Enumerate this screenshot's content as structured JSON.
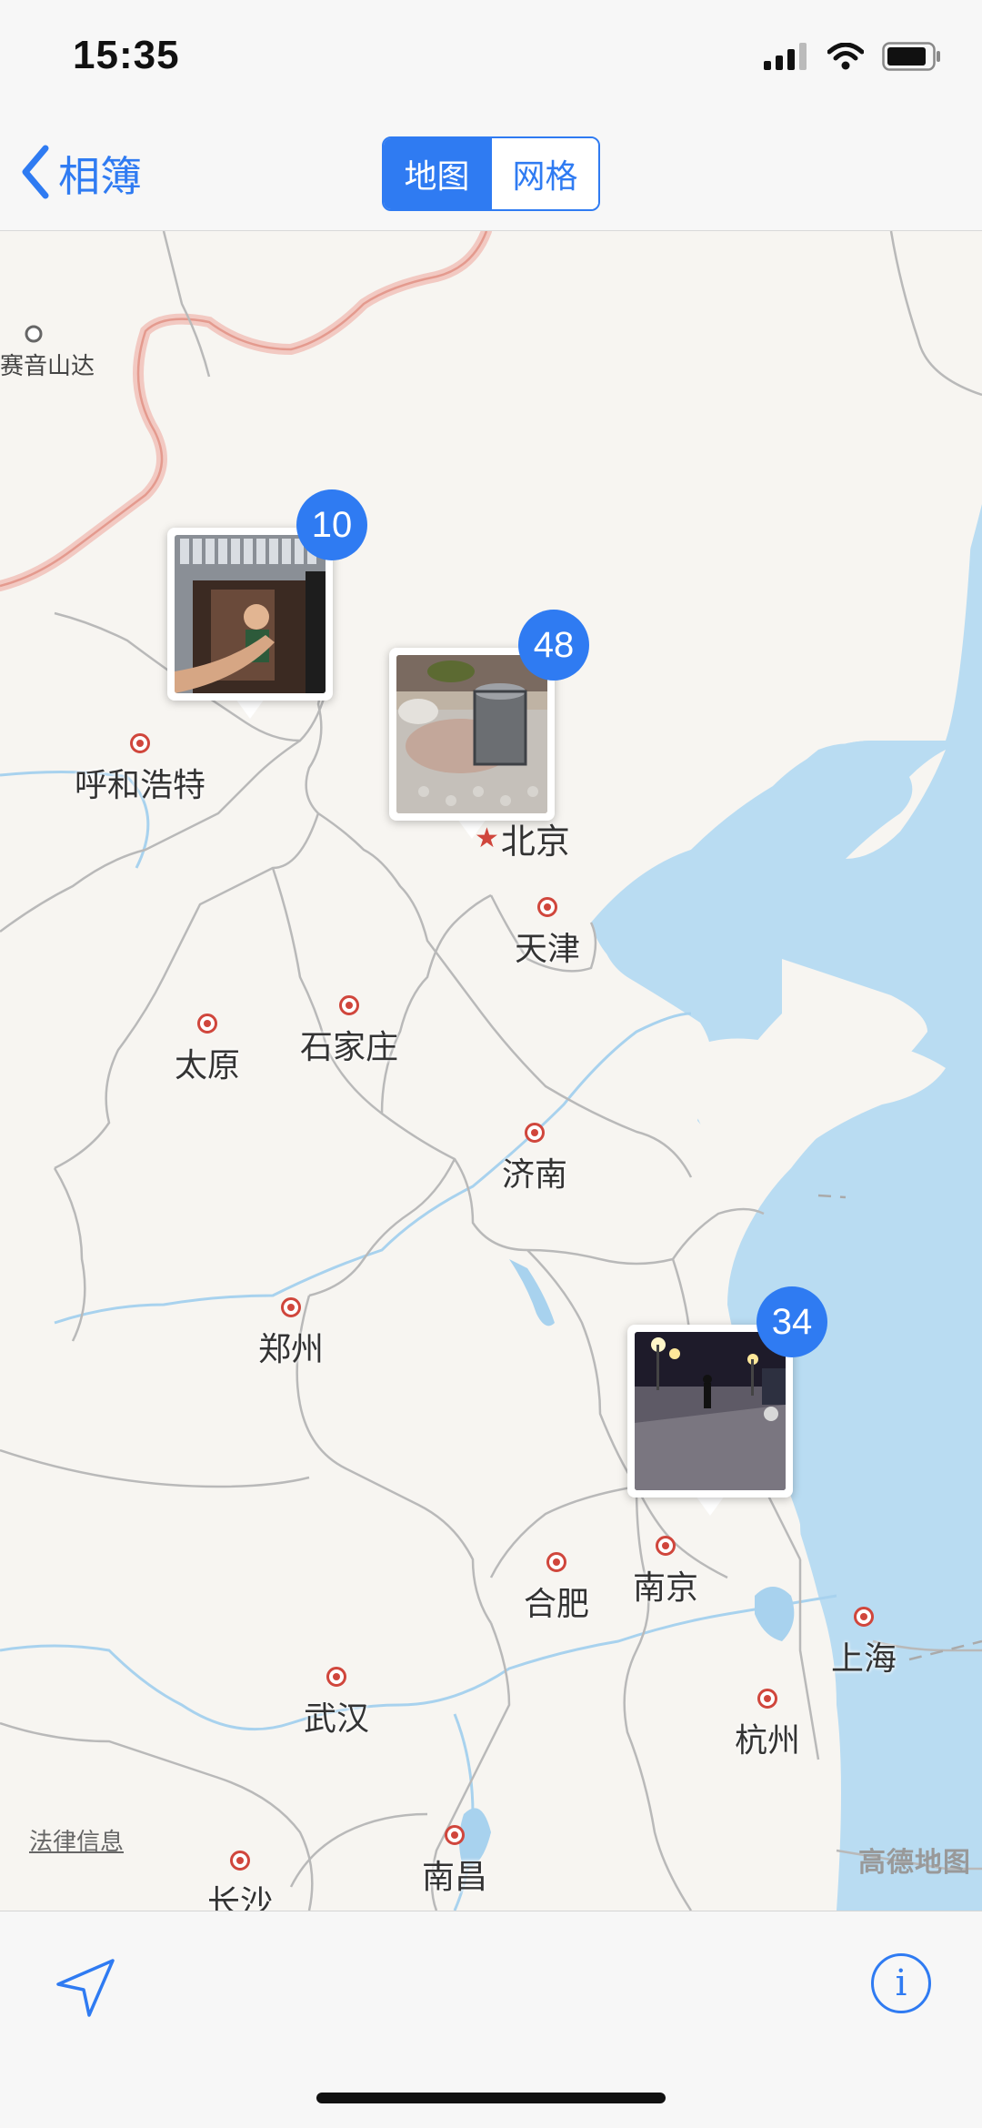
{
  "status_bar": {
    "time": "15:35"
  },
  "nav": {
    "back_label": "相簿",
    "segments": [
      "地图",
      "网格"
    ],
    "active_segment": "地图"
  },
  "map": {
    "cities": {
      "hohhot": "呼和浩特",
      "beijing": "北京",
      "tianjin": "天津",
      "taiyuan": "太原",
      "shijiazhuang": "石家庄",
      "jinan": "济南",
      "zhengzhou": "郑州",
      "hefei": "合肥",
      "nanjing": "南京",
      "shanghai": "上海",
      "wuhan": "武汉",
      "hangzhou": "杭州",
      "nanchang": "南昌",
      "changsha": "长沙"
    },
    "border_town": "赛音山达",
    "pins": [
      {
        "count": "10"
      },
      {
        "count": "48"
      },
      {
        "count": "34"
      }
    ],
    "legal_link": "法律信息",
    "provider": "高德地图"
  },
  "colors": {
    "accent": "#2f7bf2",
    "sea": "#b9dcf2",
    "land": "#f7f5f1",
    "city_dot": "#d0463c"
  }
}
